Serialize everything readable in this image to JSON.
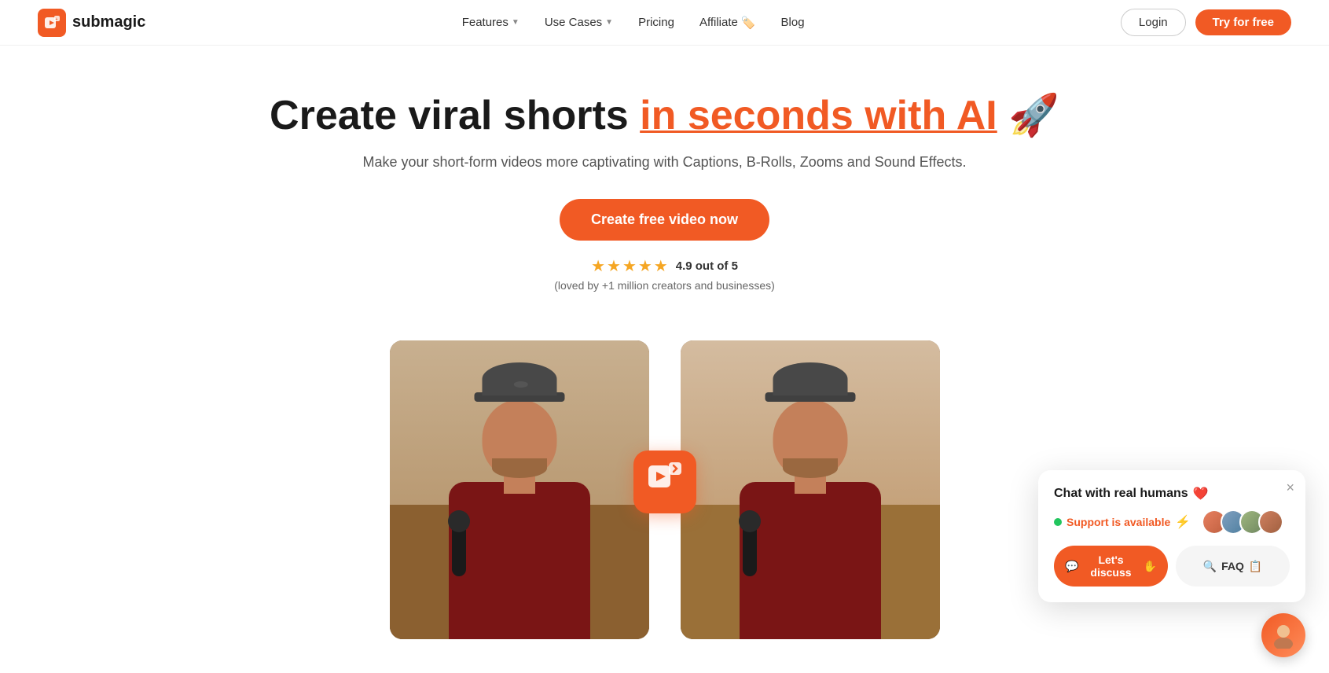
{
  "brand": {
    "logo_icon": "⚡",
    "name": "submagic"
  },
  "nav": {
    "features_label": "Features",
    "use_cases_label": "Use Cases",
    "pricing_label": "Pricing",
    "affiliate_label": "Affiliate",
    "affiliate_icon": "🏷️",
    "blog_label": "Blog",
    "login_label": "Login",
    "try_label": "Try for free"
  },
  "hero": {
    "title_part1": "Create viral shorts ",
    "title_highlight": "in seconds with AI",
    "title_emoji": "🚀",
    "subtitle": "Make your short-form videos more captivating with Captions, B-Rolls, Zooms and Sound Effects.",
    "cta_label": "Create free video now",
    "rating_stars": "★★★★★",
    "rating_score": "4.9 out of 5",
    "rating_sub": "(loved by +1 million creators and businesses)"
  },
  "chat_widget": {
    "title": "Chat with real humans",
    "title_emoji": "❤️",
    "status_dot_color": "#22c55e",
    "status_text": "Support is available",
    "status_emoji": "⚡",
    "discuss_label": "Let's discuss",
    "discuss_emoji": "✋",
    "faq_label": "FAQ",
    "faq_emoji": "📋",
    "close_label": "×"
  },
  "colors": {
    "orange": "#f15a24",
    "dark": "#1a1a1a"
  }
}
